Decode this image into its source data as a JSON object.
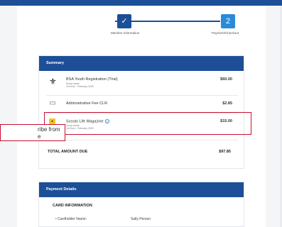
{
  "stepper": {
    "step1": {
      "caption": "Member Information",
      "icon": "checkmark-icon",
      "glyph": "✓"
    },
    "step2": {
      "caption": "Payment/Checkout",
      "icon": "number-2-icon",
      "glyph": "2"
    }
  },
  "summary": {
    "title": "Summary",
    "items": [
      {
        "name": "BSA Youth Registration (Trial)",
        "sub1": "Scout name",
        "sub2": "1st Sum - February 2020",
        "amount": "$60.00",
        "icon": "scout-emblem-icon",
        "glyph": "⚜"
      },
      {
        "name": "Administrative Fee CLR",
        "amount": "$2.85",
        "icon": "document-icon",
        "glyph": "▭"
      },
      {
        "name": "Scouts Life Magazine",
        "sub1": "Scout name",
        "sub2": "1st Sum - February 2020",
        "amount": "$15.00",
        "icon": "magazine-icon",
        "glyph": "▪",
        "help_glyph": "?"
      }
    ],
    "total_label": "TOTAL AMOUNT DUE",
    "total_amount": "$97.85"
  },
  "callout": {
    "text_line1": "ribe from",
    "text_line2": "e"
  },
  "payment": {
    "title": "Payment Details",
    "card_info_title": "CARD INFORMATION",
    "cardholder_label": "• Cardholder Name:",
    "cardholder_value": "Sally Person"
  },
  "colors": {
    "brand_blue": "#1c4f97",
    "step_current": "#2a8ad7",
    "highlight_red": "#c8102e",
    "magazine_yellow": "#f5c518"
  }
}
